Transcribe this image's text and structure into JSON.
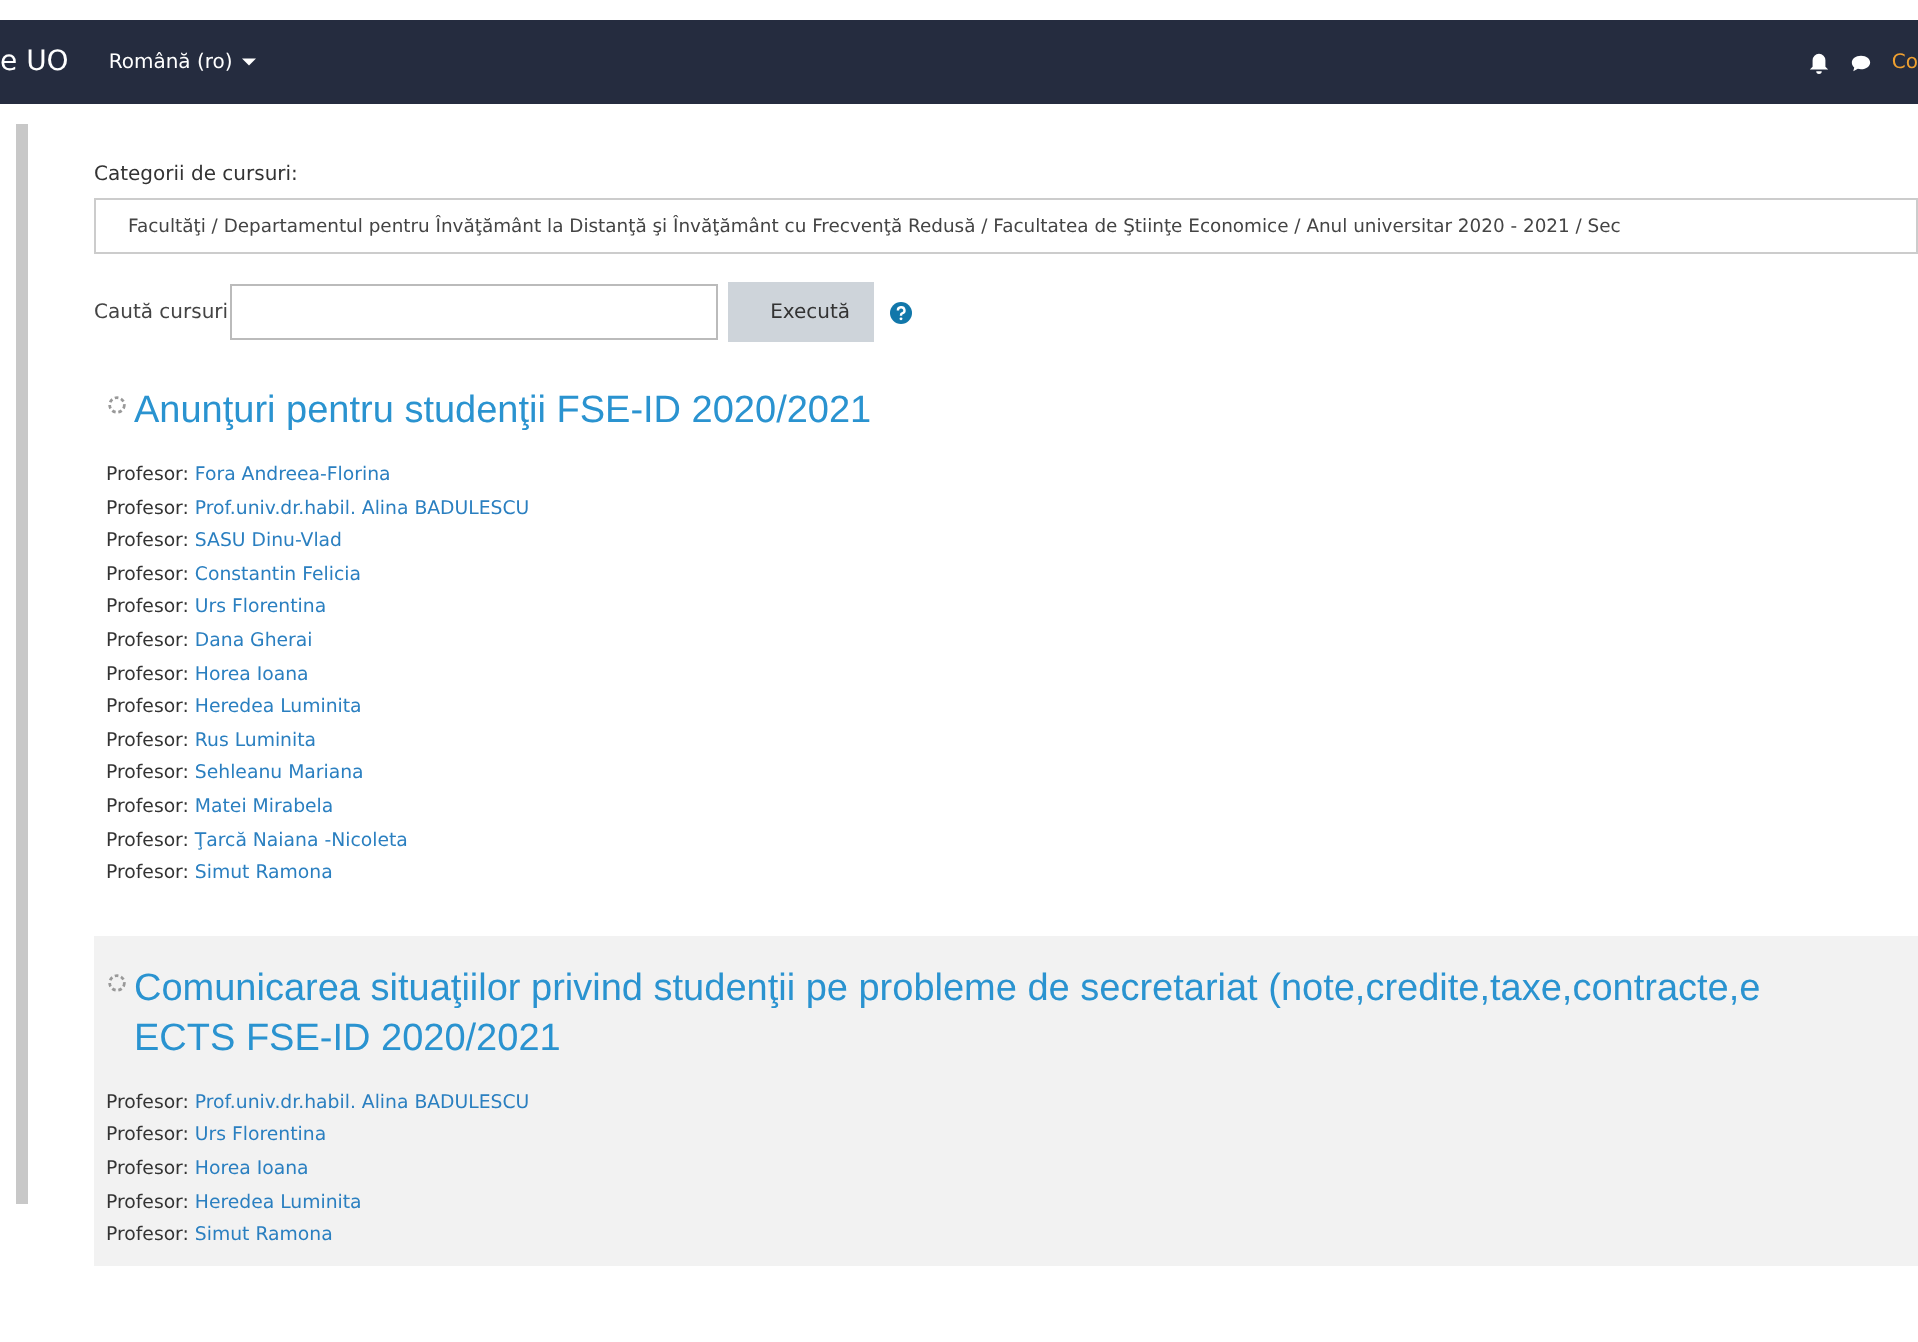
{
  "navbar": {
    "site_name": "e UO",
    "language": "Română (ro)",
    "user_link": "Co"
  },
  "category": {
    "label": "Categorii de cursuri:",
    "value": "Facultăţi / Departamentul pentru Învăţământ la Distanţă şi Învăţământ cu Frecvenţă Redusă / Facultatea de Ştiinţe Economice / Anul universitar 2020 - 2021 / Sec"
  },
  "search": {
    "label": "Caută cursuri",
    "button": "Execută"
  },
  "courses": [
    {
      "title_lines": [
        "Anunţuri pentru studenţii FSE-ID 2020/2021"
      ],
      "highlighted": false,
      "teachers": [
        {
          "role": "Profesor:",
          "name": "Fora Andreea-Florina"
        },
        {
          "role": "Profesor:",
          "name": "Prof.univ.dr.habil. Alina BADULESCU"
        },
        {
          "role": "Profesor:",
          "name": "SASU Dinu-Vlad"
        },
        {
          "role": "Profesor:",
          "name": "Constantin Felicia"
        },
        {
          "role": "Profesor:",
          "name": "Urs Florentina"
        },
        {
          "role": "Profesor:",
          "name": "Dana Gherai"
        },
        {
          "role": "Profesor:",
          "name": "Horea Ioana"
        },
        {
          "role": "Profesor:",
          "name": "Heredea Luminita"
        },
        {
          "role": "Profesor:",
          "name": "Rus Luminita"
        },
        {
          "role": "Profesor:",
          "name": "Sehleanu Mariana"
        },
        {
          "role": "Profesor:",
          "name": "Matei Mirabela"
        },
        {
          "role": "Profesor:",
          "name": "Ţarcă Naiana -Nicoleta"
        },
        {
          "role": "Profesor:",
          "name": "Simut Ramona"
        }
      ]
    },
    {
      "title_lines": [
        "Comunicarea situaţiilor privind studenţii pe probleme de secretariat (note,credite,taxe,contracte,e",
        "ECTS FSE-ID 2020/2021"
      ],
      "highlighted": true,
      "teachers": [
        {
          "role": "Profesor:",
          "name": "Prof.univ.dr.habil. Alina BADULESCU"
        },
        {
          "role": "Profesor:",
          "name": "Urs Florentina"
        },
        {
          "role": "Profesor:",
          "name": "Horea Ioana"
        },
        {
          "role": "Profesor:",
          "name": "Heredea Luminita"
        },
        {
          "role": "Profesor:",
          "name": "Simut Ramona"
        }
      ]
    }
  ]
}
